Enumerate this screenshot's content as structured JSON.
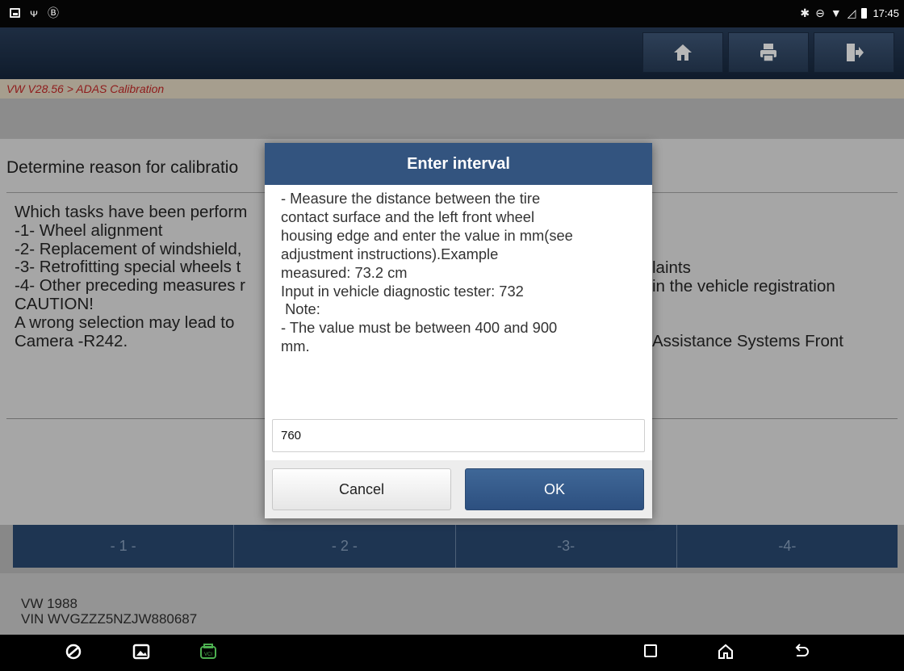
{
  "status_bar": {
    "time": "17:45"
  },
  "breadcrumb": "VW V28.56 > ADAS Calibration",
  "content": {
    "reason": "Determine reason for calibratio",
    "question_lines": [
      "Which tasks have been perform",
      "-1- Wheel alignment",
      "-2- Replacement of windshield,",
      "-3- Retrofitting special wheels t",
      "-4- Other preceding measures r",
      "CAUTION!",
      "A wrong selection may lead to",
      "Camera -R242."
    ],
    "question_right_fragments": [
      "laints",
      "in the vehicle registration",
      "Assistance Systems Front"
    ]
  },
  "choices": [
    "- 1 -",
    "- 2 -",
    "-3-",
    "-4-"
  ],
  "vehicle": {
    "model": "VW 1988",
    "vin": "VIN WVGZZZ5NZJW880687"
  },
  "dialog": {
    "title": "Enter interval",
    "body_lines": [
      "- Measure the distance between the tire",
      "contact surface and the left front wheel",
      "housing edge and enter the value in mm(see",
      "adjustment instructions).Example",
      "measured: 73.2 cm",
      "Input in vehicle diagnostic tester: 732",
      " Note:",
      "- The value must be between 400 and 900",
      "mm."
    ],
    "input_value": "760",
    "cancel_label": "Cancel",
    "ok_label": "OK"
  },
  "colors": {
    "accent": "#33547f",
    "breadcrumb_text": "#c62828",
    "vci_icon": "#4caf50"
  }
}
